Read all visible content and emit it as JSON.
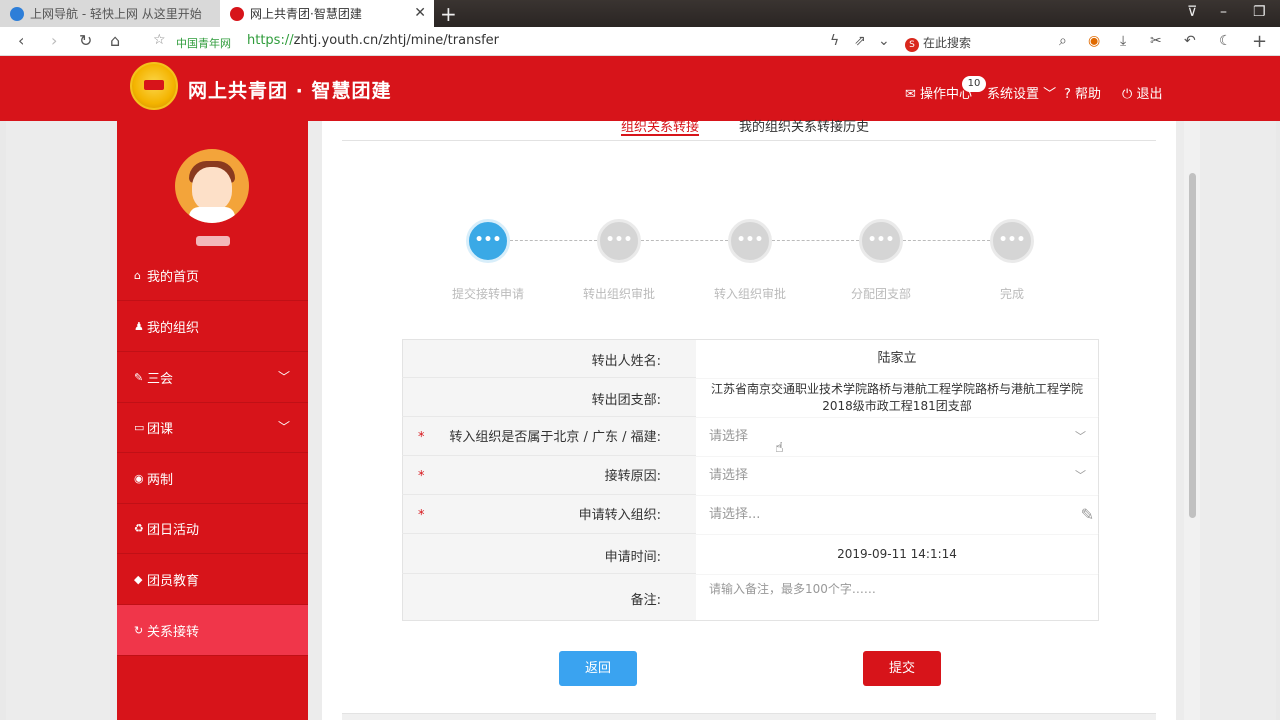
{
  "browser": {
    "tabs": [
      {
        "title": "上网导航 - 轻快上网 从这里开始",
        "active": false
      },
      {
        "title": "网上共青团·智慧团建",
        "active": true
      }
    ],
    "site_name": "中国青年网",
    "url_protocol": "https://",
    "url_rest": "zhtj.youth.cn/zhtj/mine/transfer",
    "search_label": "在此搜索"
  },
  "header": {
    "brand": "网上共青团 · 智慧团建",
    "ops_center": "操作中心",
    "ops_badge": "10",
    "settings": "系统设置",
    "help": "帮助",
    "logout": "退出"
  },
  "sidebar": {
    "items": [
      {
        "label": "我的首页",
        "icon": "home-icon"
      },
      {
        "label": "我的组织",
        "icon": "group-icon"
      },
      {
        "label": "三会",
        "icon": "edit-icon",
        "expandable": true
      },
      {
        "label": "团课",
        "icon": "folder-icon",
        "expandable": true
      },
      {
        "label": "两制",
        "icon": "circle-icon"
      },
      {
        "label": "团日活动",
        "icon": "recycle-icon"
      },
      {
        "label": "团员教育",
        "icon": "graduation-cap-icon"
      },
      {
        "label": "关系接转",
        "icon": "refresh-icon",
        "active": true
      }
    ]
  },
  "main": {
    "tabs": [
      "组织关系转接",
      "我的组织关系转接历史"
    ],
    "steps": [
      {
        "label": "提交接转申请",
        "done": true
      },
      {
        "label": "转出组织审批",
        "done": false
      },
      {
        "label": "转入组织审批",
        "done": false
      },
      {
        "label": "分配团支部",
        "done": false
      },
      {
        "label": "完成",
        "done": false
      }
    ],
    "step_dots": "•••",
    "form": {
      "out_name_label": "转出人姓名:",
      "out_name_value": "陆家立",
      "out_branch_label": "转出团支部:",
      "out_branch_value_1": "江苏省南京交通职业技术学院路桥与港航工程学院路桥与港航工程学院",
      "out_branch_value_2": "2018级市政工程181团支部",
      "region_label": "转入组织是否属于北京 / 广东 / 福建:",
      "region_placeholder": "请选择",
      "reason_label": "接转原因:",
      "reason_placeholder": "请选择",
      "target_label": "申请转入组织:",
      "target_placeholder": "请选择...",
      "time_label": "申请时间:",
      "time_value": "2019-09-11 14:1:14",
      "note_label": "备注:",
      "note_placeholder": "请输入备注，最多100个字……",
      "required_mark": "*"
    },
    "buttons": {
      "back": "返回",
      "submit": "提交"
    }
  },
  "colors": {
    "brand_red": "#d7141a",
    "active_blue": "#3aa9e6",
    "sidebar_active": "#f0364a"
  }
}
